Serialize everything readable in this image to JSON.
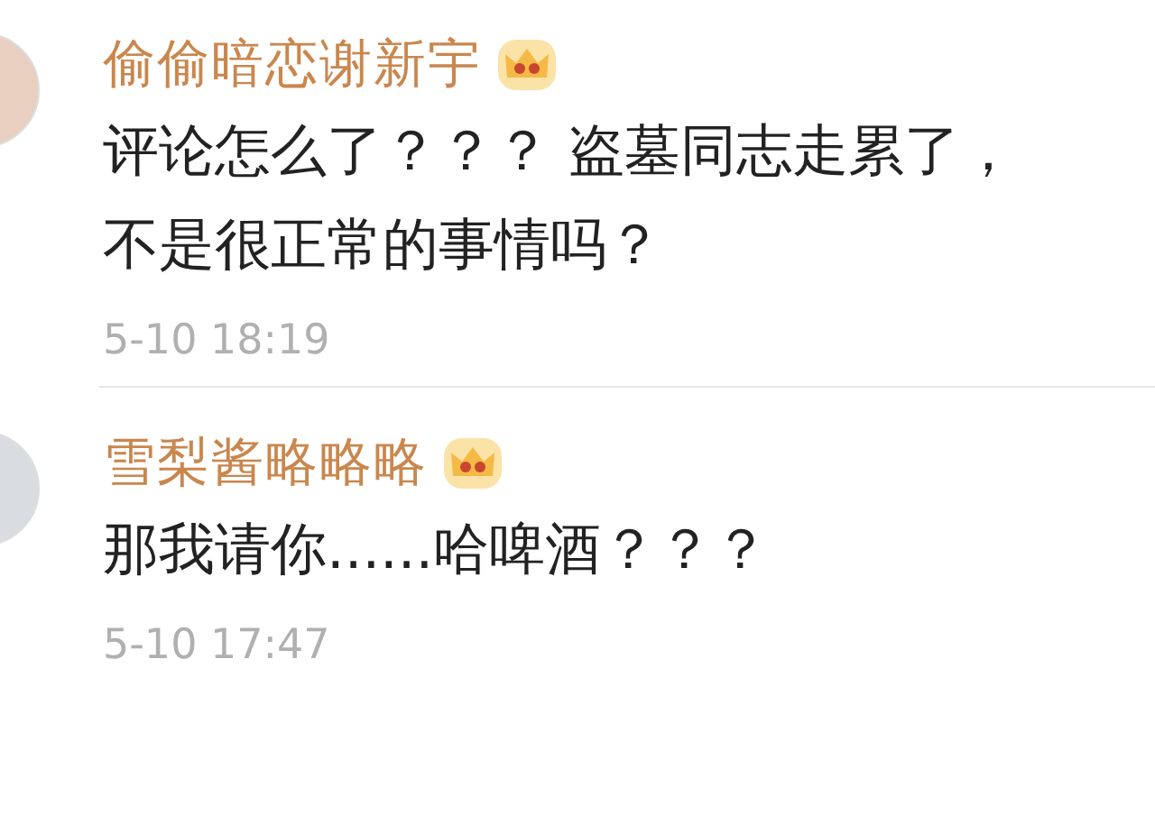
{
  "comments": [
    {
      "username": "偷偷暗恋谢新宇",
      "vip": true,
      "text_lines": [
        "评论怎么了？？？ 盗墓同志走累了，",
        "不是很正常的事情吗？"
      ],
      "time": "5-10 18:19"
    },
    {
      "username": "雪梨酱略略略",
      "vip": true,
      "text_lines": [
        "那我请你......哈啤酒？？？"
      ],
      "time": "5-10 17:47"
    }
  ]
}
